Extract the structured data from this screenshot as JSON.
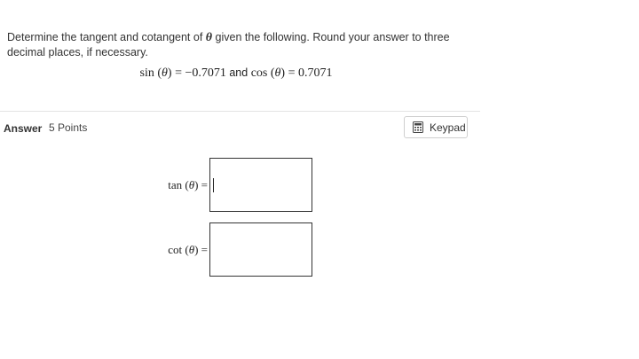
{
  "question": {
    "prefix": "Determine the tangent and cotangent of ",
    "theta": "θ",
    "suffix": " given the following. Round your answer to three decimal places, if necessary."
  },
  "given": {
    "sin_expr": "sin (",
    "theta": "θ",
    "sin_value": ") = −0.7071",
    "connector": " and ",
    "cos_expr": "cos (",
    "cos_value": ") = 0.7071"
  },
  "answer_header": {
    "label": "Answer",
    "points": "5 Points"
  },
  "keypad": {
    "label": "Keypad",
    "icon": "calculator-icon"
  },
  "inputs": {
    "tan": {
      "fn": "tan (",
      "theta": "θ",
      "tail": ") =",
      "value": ""
    },
    "cot": {
      "fn": "cot (",
      "theta": "θ",
      "tail": ") =",
      "value": ""
    }
  },
  "colors": {
    "text": "#333333",
    "divider": "#e3e3e3",
    "box_border": "#333333",
    "button_border": "#cfcfcf"
  }
}
